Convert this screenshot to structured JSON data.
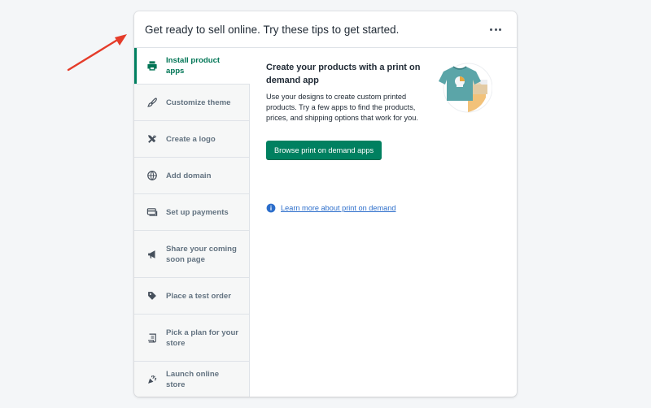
{
  "card": {
    "title": "Get ready to sell online. Try these tips to get started.",
    "more_icon": "horizontal-dots-icon"
  },
  "sidebar": {
    "items": [
      {
        "label": "Install product apps",
        "icon": "printer-icon",
        "active": true
      },
      {
        "label": "Customize theme",
        "icon": "paintbrush-icon",
        "active": false
      },
      {
        "label": "Create a logo",
        "icon": "tools-icon",
        "active": false
      },
      {
        "label": "Add domain",
        "icon": "globe-icon",
        "active": false
      },
      {
        "label": "Set up payments",
        "icon": "credit-card-icon",
        "active": false
      },
      {
        "label": "Share your coming soon page",
        "icon": "megaphone-icon",
        "active": false
      },
      {
        "label": "Place a test order",
        "icon": "tag-icon",
        "active": false
      },
      {
        "label": "Pick a plan for your store",
        "icon": "receipt-icon",
        "active": false
      },
      {
        "label": "Launch online store",
        "icon": "confetti-icon",
        "active": false
      }
    ]
  },
  "content": {
    "title": "Create your products with a print on demand app",
    "description": "Use your designs to create custom printed products. Try a few apps to find the products, prices, and shipping options that work for you.",
    "primary_button": "Browse print on demand apps",
    "learn_more": "Learn more about print on demand",
    "illustration": "tshirt-illustration"
  },
  "colors": {
    "accent": "#008060",
    "link": "#2c6ecb",
    "annotation_arrow": "#e53c2a",
    "shirt": "#5ba5a8",
    "shirt_accent": "#e8a740"
  }
}
